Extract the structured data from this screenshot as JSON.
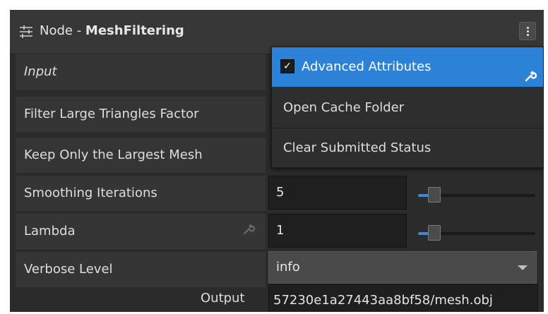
{
  "header": {
    "prefix": "Node - ",
    "node_name": "MeshFiltering",
    "node_icon": "sliders-icon",
    "menu_icon": "kebab-menu-icon"
  },
  "attributes": {
    "input_label": "Input",
    "filter_large_triangles_label": "Filter Large Triangles Factor",
    "keep_largest_mesh_label": "Keep Only the Largest Mesh",
    "smoothing_iterations": {
      "label": "Smoothing Iterations",
      "value": "5",
      "slider_fraction": 0.14
    },
    "lambda": {
      "label": "Lambda",
      "value": "1",
      "slider_fraction": 0.14
    },
    "verbose_level": {
      "label": "Verbose Level",
      "value": "info"
    },
    "output": {
      "label": "Output",
      "value": "57230e1a27443aa8bf58/mesh.obj"
    }
  },
  "context_menu": {
    "advanced_attributes": {
      "label": "Advanced Attributes",
      "checked": true,
      "check_glyph": "✓"
    },
    "open_cache_folder": "Open Cache Folder",
    "clear_submitted_status": "Clear Submitted Status"
  },
  "colors": {
    "accent": "#2c82d6",
    "panel_bg": "#2b2b2b",
    "row_bg": "#353535",
    "header_bg": "#373737"
  }
}
